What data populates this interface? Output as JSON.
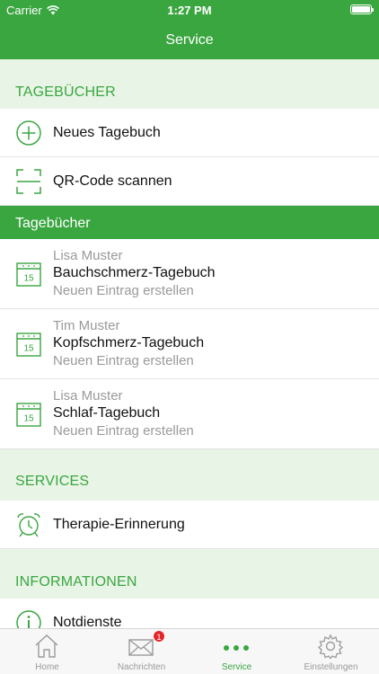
{
  "status": {
    "carrier": "Carrier",
    "time": "1:27 PM"
  },
  "nav": {
    "title": "Service"
  },
  "sections": {
    "tagebuecher": "TAGEBÜCHER",
    "diaries_band": "Tagebücher",
    "services": "SERVICES",
    "informationen": "INFORMATIONEN"
  },
  "actions": {
    "new_diary": "Neues Tagebuch",
    "qr_scan": "QR-Code scannen",
    "therapy": "Therapie-Erinnerung",
    "notdienste": "Notdienste"
  },
  "diaries": [
    {
      "person": "Lisa Muster",
      "title": "Bauchschmerz-Tagebuch",
      "action": "Neuen Eintrag erstellen",
      "day": "15"
    },
    {
      "person": "Tim Muster",
      "title": "Kopfschmerz-Tagebuch",
      "action": "Neuen Eintrag erstellen",
      "day": "15"
    },
    {
      "person": "Lisa Muster",
      "title": "Schlaf-Tagebuch",
      "action": "Neuen Eintrag erstellen",
      "day": "15"
    }
  ],
  "tabs": [
    {
      "label": "Home",
      "icon": "home-icon"
    },
    {
      "label": "Nachrichten",
      "icon": "envelope-icon",
      "badge": "1"
    },
    {
      "label": "Service",
      "icon": "more-dots-icon"
    },
    {
      "label": "Einstellungen",
      "icon": "gear-icon"
    }
  ],
  "colors": {
    "brand_green": "#3aa640",
    "section_bg": "#e8f5e6",
    "badge_red": "#e3262c",
    "inactive": "#9a9a9a"
  }
}
